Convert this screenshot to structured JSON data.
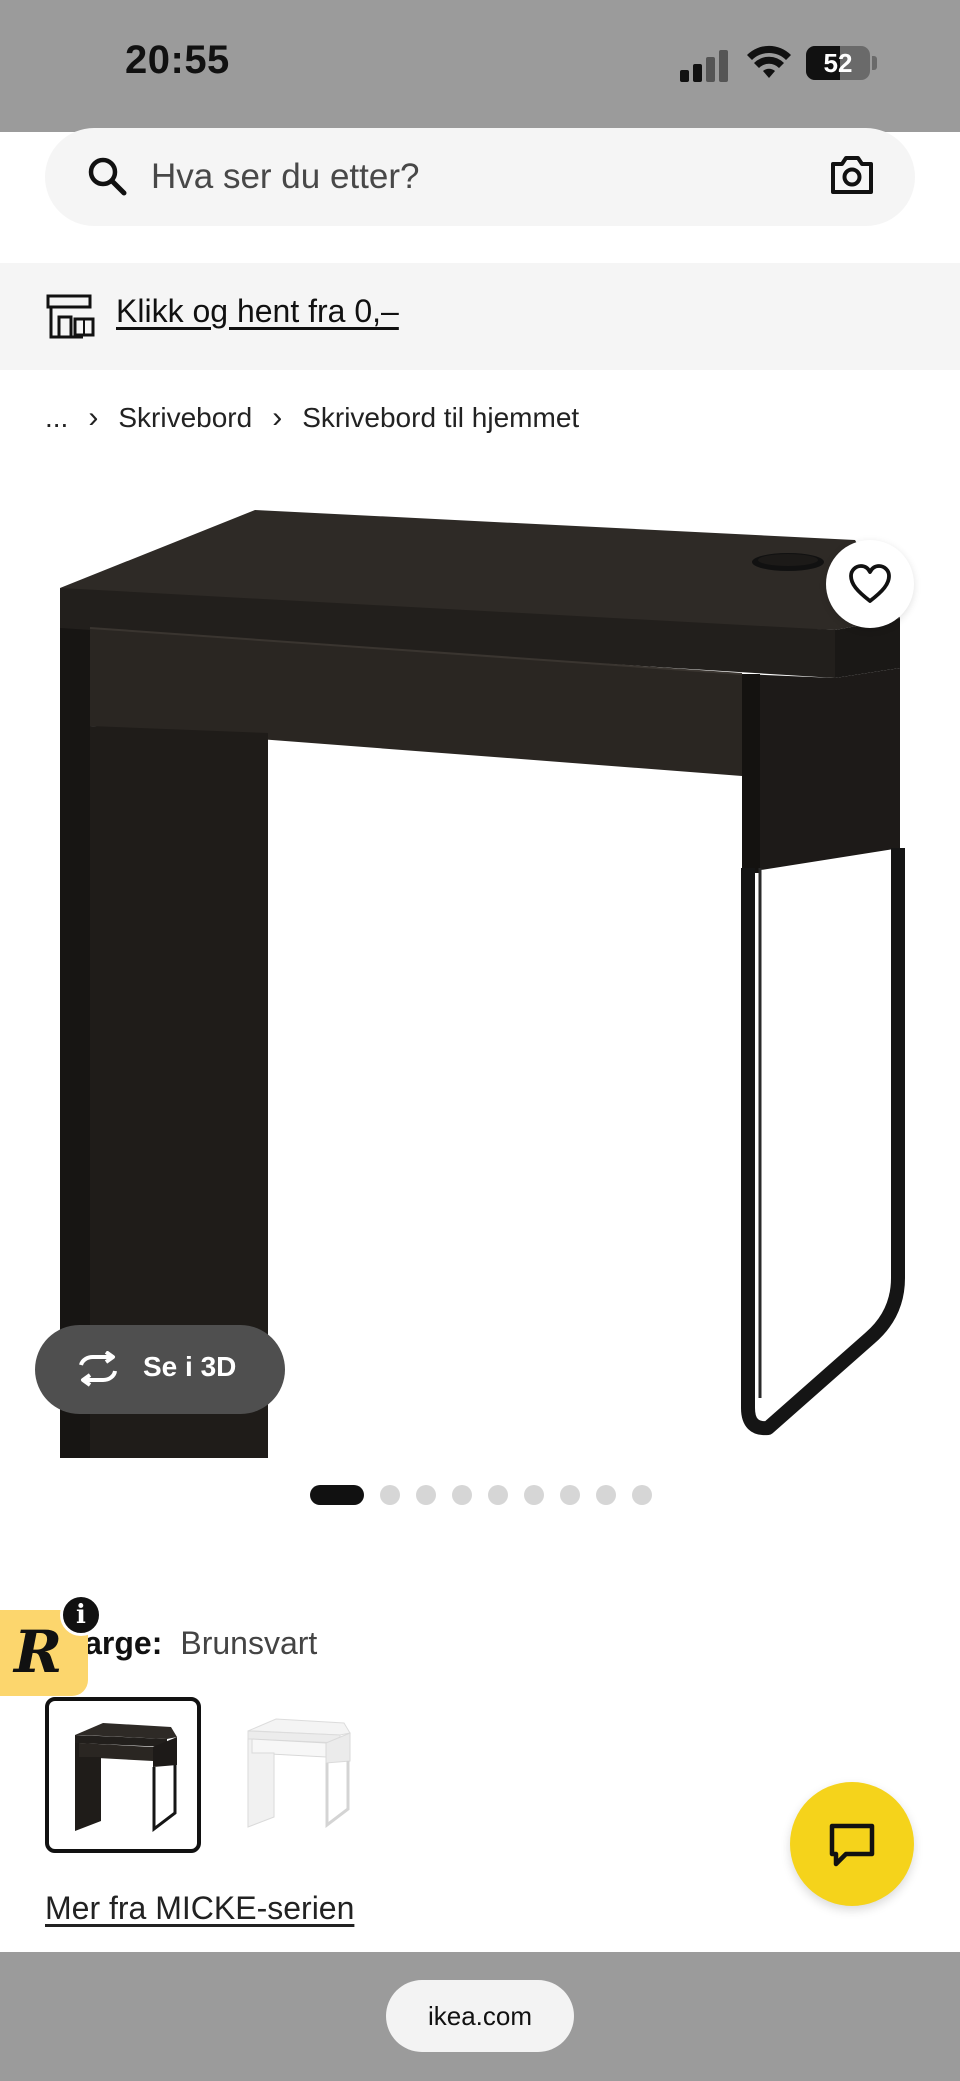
{
  "status_bar": {
    "time": "20:55",
    "battery": "52"
  },
  "search": {
    "placeholder": "Hva ser du etter?"
  },
  "banner": {
    "link_text": "Klikk og hent fra 0,–"
  },
  "breadcrumb": {
    "ellipsis": "...",
    "separator": "›",
    "items": [
      "Skrivebord",
      "Skrivebord til hjemmet"
    ]
  },
  "gallery": {
    "view_3d_label": "Se i 3D",
    "total_images": 9,
    "active_index": 0
  },
  "color": {
    "label": "g farge:",
    "value": "Brunsvart",
    "options": [
      "Brunsvart",
      "Hvit"
    ],
    "selected": "Brunsvart"
  },
  "badge": {
    "letter": "R",
    "info_glyph": "i"
  },
  "series_link": "Mer fra MICKE-serien",
  "browser": {
    "url": "ikea.com"
  },
  "colors": {
    "chat_button": "#f5d31b",
    "badge_bg": "#fcd66d",
    "desk_brown_black": "#2b2723",
    "status_bar_bg": "#9b9b9b"
  },
  "icons": [
    "search-icon",
    "camera-icon",
    "store-icon",
    "heart-icon",
    "rotate-3d-icon",
    "chat-icon"
  ]
}
